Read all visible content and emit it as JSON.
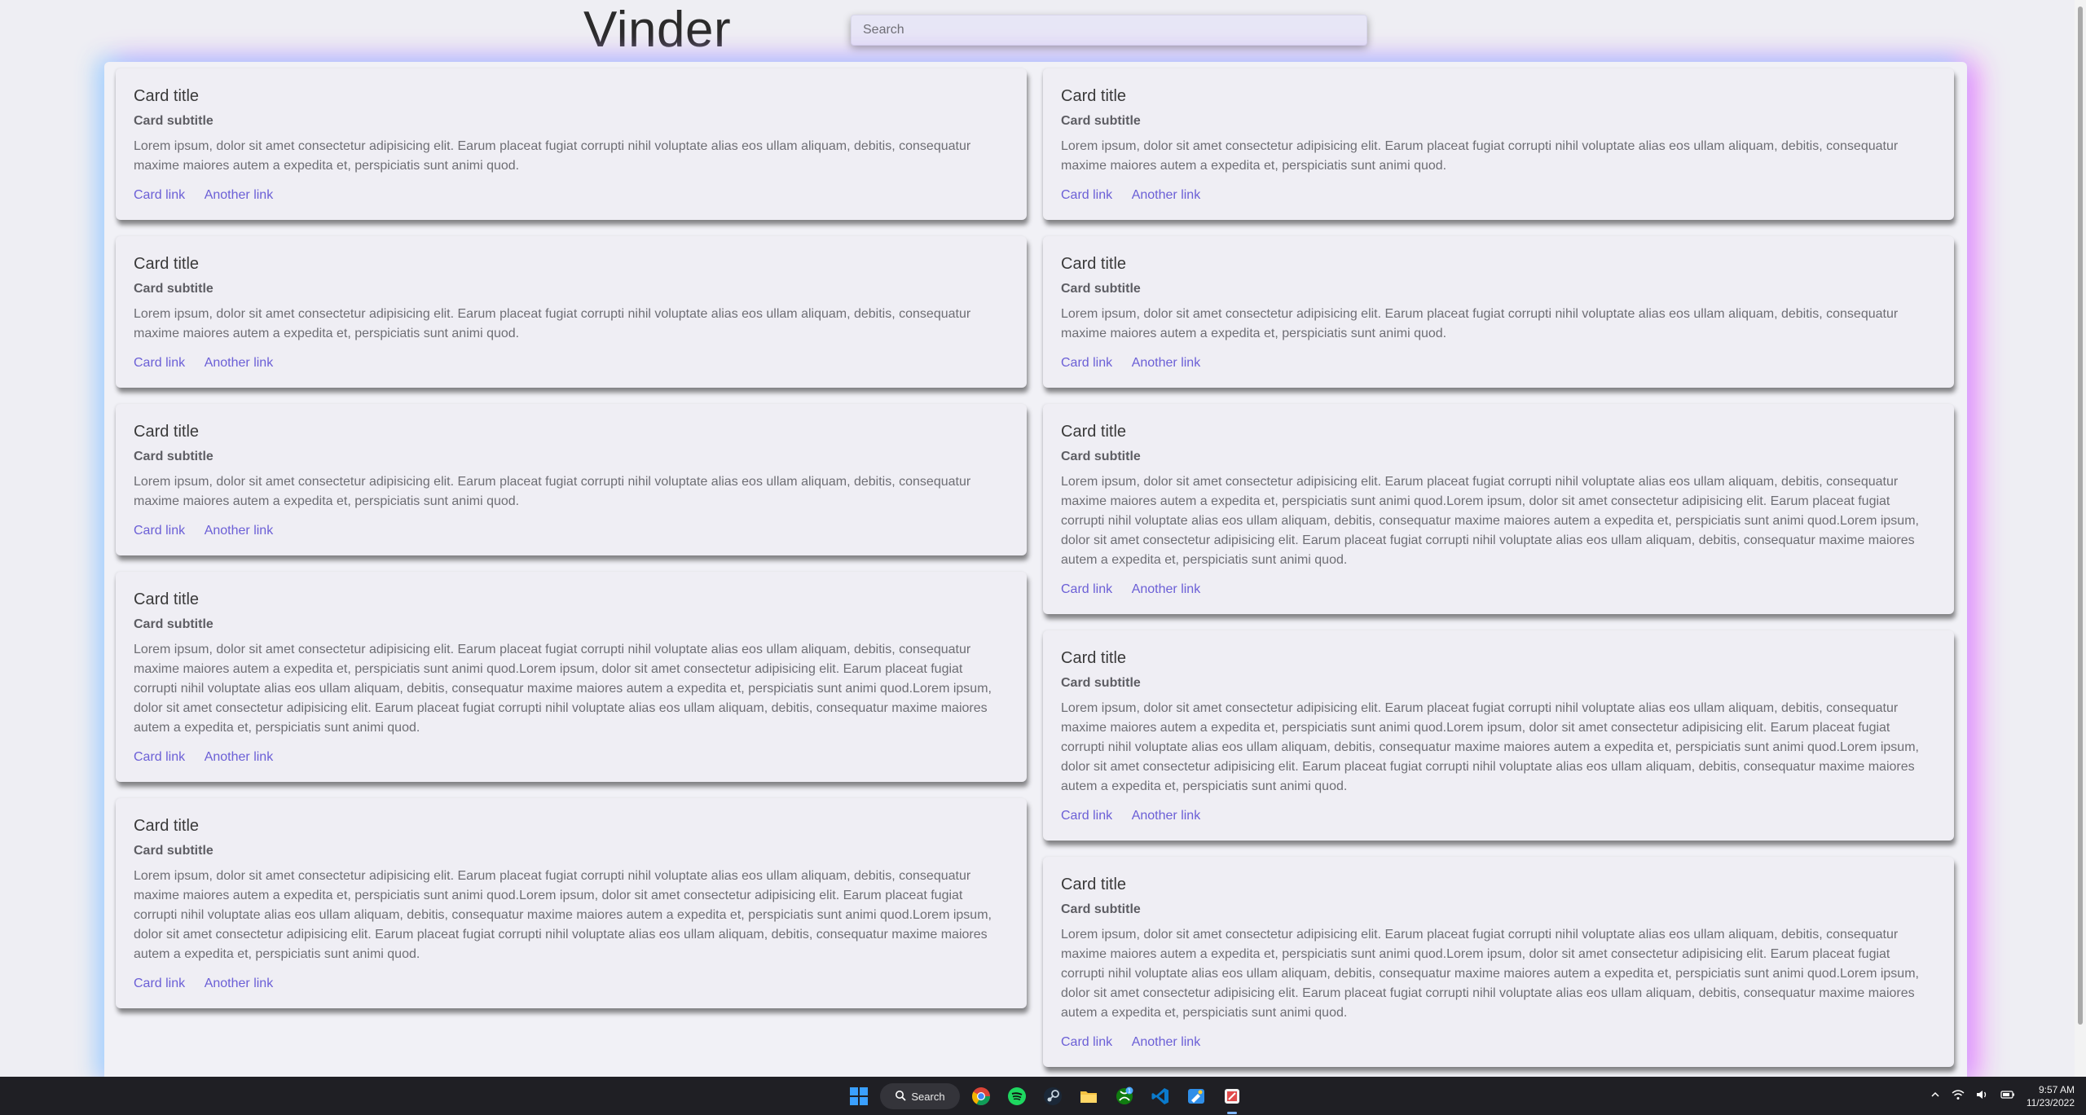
{
  "header": {
    "brand": "Vinder",
    "search_placeholder": "Search"
  },
  "cards": {
    "left": [
      {
        "title": "Card title",
        "subtitle": "Card subtitle",
        "text": "Lorem ipsum, dolor sit amet consectetur adipisicing elit. Earum placeat fugiat corrupti nihil voluptate alias eos ullam aliquam, debitis, consequatur maxime maiores autem a expedita et, perspiciatis sunt animi quod.",
        "link1": "Card link",
        "link2": "Another link"
      },
      {
        "title": "Card title",
        "subtitle": "Card subtitle",
        "text": "Lorem ipsum, dolor sit amet consectetur adipisicing elit. Earum placeat fugiat corrupti nihil voluptate alias eos ullam aliquam, debitis, consequatur maxime maiores autem a expedita et, perspiciatis sunt animi quod.",
        "link1": "Card link",
        "link2": "Another link"
      },
      {
        "title": "Card title",
        "subtitle": "Card subtitle",
        "text": "Lorem ipsum, dolor sit amet consectetur adipisicing elit. Earum placeat fugiat corrupti nihil voluptate alias eos ullam aliquam, debitis, consequatur maxime maiores autem a expedita et, perspiciatis sunt animi quod.",
        "link1": "Card link",
        "link2": "Another link"
      },
      {
        "title": "Card title",
        "subtitle": "Card subtitle",
        "text": "Lorem ipsum, dolor sit amet consectetur adipisicing elit. Earum placeat fugiat corrupti nihil voluptate alias eos ullam aliquam, debitis, consequatur maxime maiores autem a expedita et, perspiciatis sunt animi quod.Lorem ipsum, dolor sit amet consectetur adipisicing elit. Earum placeat fugiat corrupti nihil voluptate alias eos ullam aliquam, debitis, consequatur maxime maiores autem a expedita et, perspiciatis sunt animi quod.Lorem ipsum, dolor sit amet consectetur adipisicing elit. Earum placeat fugiat corrupti nihil voluptate alias eos ullam aliquam, debitis, consequatur maxime maiores autem a expedita et, perspiciatis sunt animi quod.",
        "link1": "Card link",
        "link2": "Another link"
      },
      {
        "title": "Card title",
        "subtitle": "Card subtitle",
        "text": "Lorem ipsum, dolor sit amet consectetur adipisicing elit. Earum placeat fugiat corrupti nihil voluptate alias eos ullam aliquam, debitis, consequatur maxime maiores autem a expedita et, perspiciatis sunt animi quod.Lorem ipsum, dolor sit amet consectetur adipisicing elit. Earum placeat fugiat corrupti nihil voluptate alias eos ullam aliquam, debitis, consequatur maxime maiores autem a expedita et, perspiciatis sunt animi quod.Lorem ipsum, dolor sit amet consectetur adipisicing elit. Earum placeat fugiat corrupti nihil voluptate alias eos ullam aliquam, debitis, consequatur maxime maiores autem a expedita et, perspiciatis sunt animi quod.",
        "link1": "Card link",
        "link2": "Another link"
      }
    ],
    "right": [
      {
        "title": "Card title",
        "subtitle": "Card subtitle",
        "text": "Lorem ipsum, dolor sit amet consectetur adipisicing elit. Earum placeat fugiat corrupti nihil voluptate alias eos ullam aliquam, debitis, consequatur maxime maiores autem a expedita et, perspiciatis sunt animi quod.",
        "link1": "Card link",
        "link2": "Another link"
      },
      {
        "title": "Card title",
        "subtitle": "Card subtitle",
        "text": "Lorem ipsum, dolor sit amet consectetur adipisicing elit. Earum placeat fugiat corrupti nihil voluptate alias eos ullam aliquam, debitis, consequatur maxime maiores autem a expedita et, perspiciatis sunt animi quod.",
        "link1": "Card link",
        "link2": "Another link"
      },
      {
        "title": "Card title",
        "subtitle": "Card subtitle",
        "text": "Lorem ipsum, dolor sit amet consectetur adipisicing elit. Earum placeat fugiat corrupti nihil voluptate alias eos ullam aliquam, debitis, consequatur maxime maiores autem a expedita et, perspiciatis sunt animi quod.Lorem ipsum, dolor sit amet consectetur adipisicing elit. Earum placeat fugiat corrupti nihil voluptate alias eos ullam aliquam, debitis, consequatur maxime maiores autem a expedita et, perspiciatis sunt animi quod.Lorem ipsum, dolor sit amet consectetur adipisicing elit. Earum placeat fugiat corrupti nihil voluptate alias eos ullam aliquam, debitis, consequatur maxime maiores autem a expedita et, perspiciatis sunt animi quod.",
        "link1": "Card link",
        "link2": "Another link"
      },
      {
        "title": "Card title",
        "subtitle": "Card subtitle",
        "text": "Lorem ipsum, dolor sit amet consectetur adipisicing elit. Earum placeat fugiat corrupti nihil voluptate alias eos ullam aliquam, debitis, consequatur maxime maiores autem a expedita et, perspiciatis sunt animi quod.Lorem ipsum, dolor sit amet consectetur adipisicing elit. Earum placeat fugiat corrupti nihil voluptate alias eos ullam aliquam, debitis, consequatur maxime maiores autem a expedita et, perspiciatis sunt animi quod.Lorem ipsum, dolor sit amet consectetur adipisicing elit. Earum placeat fugiat corrupti nihil voluptate alias eos ullam aliquam, debitis, consequatur maxime maiores autem a expedita et, perspiciatis sunt animi quod.",
        "link1": "Card link",
        "link2": "Another link"
      },
      {
        "title": "Card title",
        "subtitle": "Card subtitle",
        "text": "Lorem ipsum, dolor sit amet consectetur adipisicing elit. Earum placeat fugiat corrupti nihil voluptate alias eos ullam aliquam, debitis, consequatur maxime maiores autem a expedita et, perspiciatis sunt animi quod.Lorem ipsum, dolor sit amet consectetur adipisicing elit. Earum placeat fugiat corrupti nihil voluptate alias eos ullam aliquam, debitis, consequatur maxime maiores autem a expedita et, perspiciatis sunt animi quod.Lorem ipsum, dolor sit amet consectetur adipisicing elit. Earum placeat fugiat corrupti nihil voluptate alias eos ullam aliquam, debitis, consequatur maxime maiores autem a expedita et, perspiciatis sunt animi quod.",
        "link1": "Card link",
        "link2": "Another link"
      }
    ]
  },
  "taskbar": {
    "search_label": "Search",
    "icons": [
      "windows-start-icon",
      "search-icon",
      "chrome-icon",
      "spotify-icon",
      "steam-icon",
      "file-explorer-icon",
      "xbox-icon",
      "vscode-icon",
      "paint-icon",
      "snipping-icon"
    ],
    "xbox_badge": "1",
    "time": "9:57 AM",
    "date": "11/23/2022"
  },
  "colors": {
    "link": "#6b5fd6",
    "glow_left": "#96d7ff",
    "glow_right": "#eb78ff",
    "taskbar": "#1f1f24"
  }
}
